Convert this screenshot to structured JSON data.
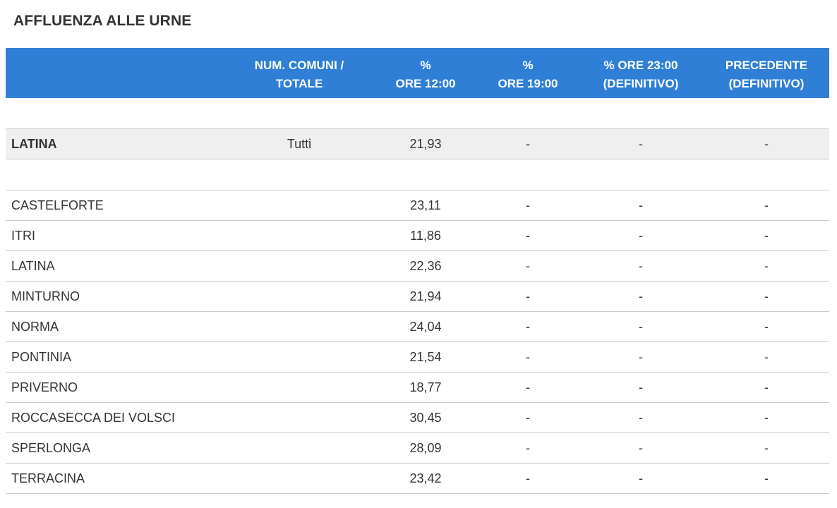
{
  "title": "AFFLUENZA ALLE URNE",
  "header": {
    "col_comuni": [
      "NUM. COMUNI /",
      "TOTALE"
    ],
    "col_ore12": [
      "%",
      "ORE 12:00"
    ],
    "col_ore19": [
      "%",
      "ORE 19:00"
    ],
    "col_ore23": [
      "% ORE 23:00",
      "(DEFINITIVO)"
    ],
    "col_precedente": [
      "PRECEDENTE",
      "(DEFINITIVO)"
    ]
  },
  "total_row": {
    "name": "LATINA",
    "comuni": "Tutti",
    "ore12": "21,93",
    "ore19": "-",
    "ore23": "-",
    "precedente": "-"
  },
  "rows": [
    {
      "name": "CASTELFORTE",
      "comuni": "",
      "ore12": "23,11",
      "ore19": "-",
      "ore23": "-",
      "precedente": "-"
    },
    {
      "name": "ITRI",
      "comuni": "",
      "ore12": "11,86",
      "ore19": "-",
      "ore23": "-",
      "precedente": "-"
    },
    {
      "name": "LATINA",
      "comuni": "",
      "ore12": "22,36",
      "ore19": "-",
      "ore23": "-",
      "precedente": "-"
    },
    {
      "name": "MINTURNO",
      "comuni": "",
      "ore12": "21,94",
      "ore19": "-",
      "ore23": "-",
      "precedente": "-"
    },
    {
      "name": "NORMA",
      "comuni": "",
      "ore12": "24,04",
      "ore19": "-",
      "ore23": "-",
      "precedente": "-"
    },
    {
      "name": "PONTINIA",
      "comuni": "",
      "ore12": "21,54",
      "ore19": "-",
      "ore23": "-",
      "precedente": "-"
    },
    {
      "name": "PRIVERNO",
      "comuni": "",
      "ore12": "18,77",
      "ore19": "-",
      "ore23": "-",
      "precedente": "-"
    },
    {
      "name": "ROCCASECCA DEI VOLSCI",
      "comuni": "",
      "ore12": "30,45",
      "ore19": "-",
      "ore23": "-",
      "precedente": "-"
    },
    {
      "name": "SPERLONGA",
      "comuni": "",
      "ore12": "28,09",
      "ore19": "-",
      "ore23": "-",
      "precedente": "-"
    },
    {
      "name": "TERRACINA",
      "comuni": "",
      "ore12": "23,42",
      "ore19": "-",
      "ore23": "-",
      "precedente": "-"
    }
  ],
  "colors": {
    "header_bg": "#2f7fd6",
    "header_text": "#ffffff",
    "total_row_bg": "#efefef",
    "text": "#333333"
  }
}
